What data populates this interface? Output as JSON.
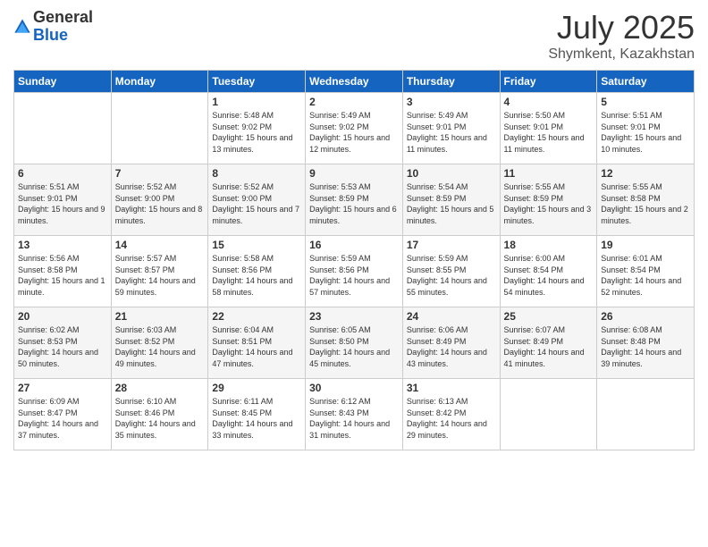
{
  "logo": {
    "general": "General",
    "blue": "Blue"
  },
  "header": {
    "month_year": "July 2025",
    "location": "Shymkent, Kazakhstan"
  },
  "weekdays": [
    "Sunday",
    "Monday",
    "Tuesday",
    "Wednesday",
    "Thursday",
    "Friday",
    "Saturday"
  ],
  "weeks": [
    [
      {
        "day": "",
        "sunrise": "",
        "sunset": "",
        "daylight": ""
      },
      {
        "day": "",
        "sunrise": "",
        "sunset": "",
        "daylight": ""
      },
      {
        "day": "1",
        "sunrise": "Sunrise: 5:48 AM",
        "sunset": "Sunset: 9:02 PM",
        "daylight": "Daylight: 15 hours and 13 minutes."
      },
      {
        "day": "2",
        "sunrise": "Sunrise: 5:49 AM",
        "sunset": "Sunset: 9:02 PM",
        "daylight": "Daylight: 15 hours and 12 minutes."
      },
      {
        "day": "3",
        "sunrise": "Sunrise: 5:49 AM",
        "sunset": "Sunset: 9:01 PM",
        "daylight": "Daylight: 15 hours and 11 minutes."
      },
      {
        "day": "4",
        "sunrise": "Sunrise: 5:50 AM",
        "sunset": "Sunset: 9:01 PM",
        "daylight": "Daylight: 15 hours and 11 minutes."
      },
      {
        "day": "5",
        "sunrise": "Sunrise: 5:51 AM",
        "sunset": "Sunset: 9:01 PM",
        "daylight": "Daylight: 15 hours and 10 minutes."
      }
    ],
    [
      {
        "day": "6",
        "sunrise": "Sunrise: 5:51 AM",
        "sunset": "Sunset: 9:01 PM",
        "daylight": "Daylight: 15 hours and 9 minutes."
      },
      {
        "day": "7",
        "sunrise": "Sunrise: 5:52 AM",
        "sunset": "Sunset: 9:00 PM",
        "daylight": "Daylight: 15 hours and 8 minutes."
      },
      {
        "day": "8",
        "sunrise": "Sunrise: 5:52 AM",
        "sunset": "Sunset: 9:00 PM",
        "daylight": "Daylight: 15 hours and 7 minutes."
      },
      {
        "day": "9",
        "sunrise": "Sunrise: 5:53 AM",
        "sunset": "Sunset: 8:59 PM",
        "daylight": "Daylight: 15 hours and 6 minutes."
      },
      {
        "day": "10",
        "sunrise": "Sunrise: 5:54 AM",
        "sunset": "Sunset: 8:59 PM",
        "daylight": "Daylight: 15 hours and 5 minutes."
      },
      {
        "day": "11",
        "sunrise": "Sunrise: 5:55 AM",
        "sunset": "Sunset: 8:59 PM",
        "daylight": "Daylight: 15 hours and 3 minutes."
      },
      {
        "day": "12",
        "sunrise": "Sunrise: 5:55 AM",
        "sunset": "Sunset: 8:58 PM",
        "daylight": "Daylight: 15 hours and 2 minutes."
      }
    ],
    [
      {
        "day": "13",
        "sunrise": "Sunrise: 5:56 AM",
        "sunset": "Sunset: 8:58 PM",
        "daylight": "Daylight: 15 hours and 1 minute."
      },
      {
        "day": "14",
        "sunrise": "Sunrise: 5:57 AM",
        "sunset": "Sunset: 8:57 PM",
        "daylight": "Daylight: 14 hours and 59 minutes."
      },
      {
        "day": "15",
        "sunrise": "Sunrise: 5:58 AM",
        "sunset": "Sunset: 8:56 PM",
        "daylight": "Daylight: 14 hours and 58 minutes."
      },
      {
        "day": "16",
        "sunrise": "Sunrise: 5:59 AM",
        "sunset": "Sunset: 8:56 PM",
        "daylight": "Daylight: 14 hours and 57 minutes."
      },
      {
        "day": "17",
        "sunrise": "Sunrise: 5:59 AM",
        "sunset": "Sunset: 8:55 PM",
        "daylight": "Daylight: 14 hours and 55 minutes."
      },
      {
        "day": "18",
        "sunrise": "Sunrise: 6:00 AM",
        "sunset": "Sunset: 8:54 PM",
        "daylight": "Daylight: 14 hours and 54 minutes."
      },
      {
        "day": "19",
        "sunrise": "Sunrise: 6:01 AM",
        "sunset": "Sunset: 8:54 PM",
        "daylight": "Daylight: 14 hours and 52 minutes."
      }
    ],
    [
      {
        "day": "20",
        "sunrise": "Sunrise: 6:02 AM",
        "sunset": "Sunset: 8:53 PM",
        "daylight": "Daylight: 14 hours and 50 minutes."
      },
      {
        "day": "21",
        "sunrise": "Sunrise: 6:03 AM",
        "sunset": "Sunset: 8:52 PM",
        "daylight": "Daylight: 14 hours and 49 minutes."
      },
      {
        "day": "22",
        "sunrise": "Sunrise: 6:04 AM",
        "sunset": "Sunset: 8:51 PM",
        "daylight": "Daylight: 14 hours and 47 minutes."
      },
      {
        "day": "23",
        "sunrise": "Sunrise: 6:05 AM",
        "sunset": "Sunset: 8:50 PM",
        "daylight": "Daylight: 14 hours and 45 minutes."
      },
      {
        "day": "24",
        "sunrise": "Sunrise: 6:06 AM",
        "sunset": "Sunset: 8:49 PM",
        "daylight": "Daylight: 14 hours and 43 minutes."
      },
      {
        "day": "25",
        "sunrise": "Sunrise: 6:07 AM",
        "sunset": "Sunset: 8:49 PM",
        "daylight": "Daylight: 14 hours and 41 minutes."
      },
      {
        "day": "26",
        "sunrise": "Sunrise: 6:08 AM",
        "sunset": "Sunset: 8:48 PM",
        "daylight": "Daylight: 14 hours and 39 minutes."
      }
    ],
    [
      {
        "day": "27",
        "sunrise": "Sunrise: 6:09 AM",
        "sunset": "Sunset: 8:47 PM",
        "daylight": "Daylight: 14 hours and 37 minutes."
      },
      {
        "day": "28",
        "sunrise": "Sunrise: 6:10 AM",
        "sunset": "Sunset: 8:46 PM",
        "daylight": "Daylight: 14 hours and 35 minutes."
      },
      {
        "day": "29",
        "sunrise": "Sunrise: 6:11 AM",
        "sunset": "Sunset: 8:45 PM",
        "daylight": "Daylight: 14 hours and 33 minutes."
      },
      {
        "day": "30",
        "sunrise": "Sunrise: 6:12 AM",
        "sunset": "Sunset: 8:43 PM",
        "daylight": "Daylight: 14 hours and 31 minutes."
      },
      {
        "day": "31",
        "sunrise": "Sunrise: 6:13 AM",
        "sunset": "Sunset: 8:42 PM",
        "daylight": "Daylight: 14 hours and 29 minutes."
      },
      {
        "day": "",
        "sunrise": "",
        "sunset": "",
        "daylight": ""
      },
      {
        "day": "",
        "sunrise": "",
        "sunset": "",
        "daylight": ""
      }
    ]
  ]
}
